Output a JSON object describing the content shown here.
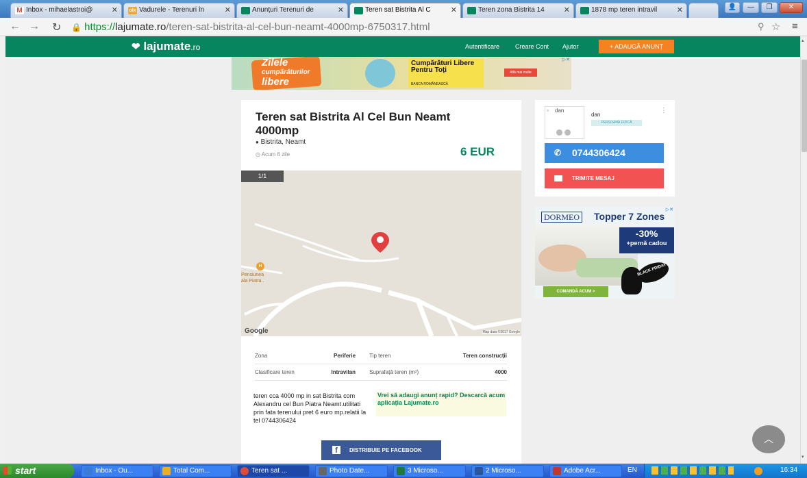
{
  "browser": {
    "tabs": [
      {
        "label": "Inbox - mihaelastroi@",
        "favicon_color": "#d44638"
      },
      {
        "label": "Vadurele - Terenuri în",
        "favicon_color": "#f0a830"
      },
      {
        "label": "Anunțuri Terenuri de",
        "favicon_color": "#07855f"
      },
      {
        "label": "Teren sat Bistrita Al C",
        "favicon_color": "#07855f"
      },
      {
        "label": "Teren zona Bistrita 14",
        "favicon_color": "#07855f"
      },
      {
        "label": "1878 mp teren intravil",
        "favicon_color": "#07855f"
      }
    ],
    "active_tab": 3,
    "url": "https://lajumate.ro/teren-sat-bistrita-al-cel-bun-neamt-4000mp-6750317.html",
    "url_scheme": "https://",
    "url_host": "lajumate.ro",
    "url_path": "/teren-sat-bistrita-al-cel-bun-neamt-4000mp-6750317.html"
  },
  "site": {
    "logo": "lajumate",
    "logo_suffix": ".ro",
    "nav": [
      "Autentificare",
      "Creare Cont",
      "Ajutor"
    ],
    "post_ad": "+ ADAUGĂ ANUNȚ",
    "brand_color": "#07855f"
  },
  "top_ad": {
    "line1": "Zilele",
    "line2": "cumpărăturilor",
    "line3": "libere",
    "headline": "Cumpărături Libere Pentru Toți",
    "bank": "BANCA ROMÂNEASCĂ",
    "cta": "Află mai multe"
  },
  "listing": {
    "title": "Teren sat Bistrita Al Cel Bun Neamt 4000mp",
    "location": "Bistrita, Neamt",
    "posted": "Acum 6 zile",
    "price": "6 EUR",
    "photo_counter": "1/1",
    "map_poi": "Pensiunea\nala Piatra..",
    "map_brand": "Google",
    "map_credit": "Map data ©2017 Google",
    "details": [
      {
        "label": "Zona",
        "value": "Periferie",
        "label2": "Tip teren",
        "value2": "Teren construcții"
      },
      {
        "label": "Clasificare teren",
        "value": "Intravilan",
        "label2": "Suprafață teren (m²)",
        "value2": "4000"
      }
    ],
    "description": "teren cca 4000 mp in sat Bistrita com Alexandru cel Bun Piatra Neamt.utilitati prin fata terenului pret 6 euro mp.relatii la tel 0744306424",
    "app_promo": "Vrei să adaugi anunț rapid? Descarcă acum aplicația Lajumate.ro",
    "share_button": "DISTRIBUIE PE FACEBOOK"
  },
  "seller": {
    "avatar_alt": "dan",
    "name": "dan",
    "type": "PERSOANĂ FIZICĂ",
    "phone": "0744306424",
    "message_button": "TRIMITE MESAJ"
  },
  "side_ad": {
    "brand": "DORMEO",
    "headline": "Topper 7 Zones",
    "discount": "-30%",
    "bonus": "+pernă cadou",
    "badge": "BLACK FRIDAY",
    "cta": "COMANDĂ ACUM >"
  },
  "taskbar": {
    "start": "start",
    "tasks": [
      {
        "label": "Inbox - Ou...",
        "icon_color": "#3a7bd5"
      },
      {
        "label": "Total Com...",
        "icon_color": "#e8b020"
      },
      {
        "label": "Teren sat ...",
        "icon_color": "#dd4b39"
      },
      {
        "label": "Photo Date...",
        "icon_color": "#666666"
      },
      {
        "label": "3 Microso...",
        "icon_color": "#1f7a3a"
      },
      {
        "label": "2 Microso...",
        "icon_color": "#2b579a"
      },
      {
        "label": "Adobe Acr...",
        "icon_color": "#c0392b"
      }
    ],
    "lang": "EN",
    "time": "16:34"
  }
}
